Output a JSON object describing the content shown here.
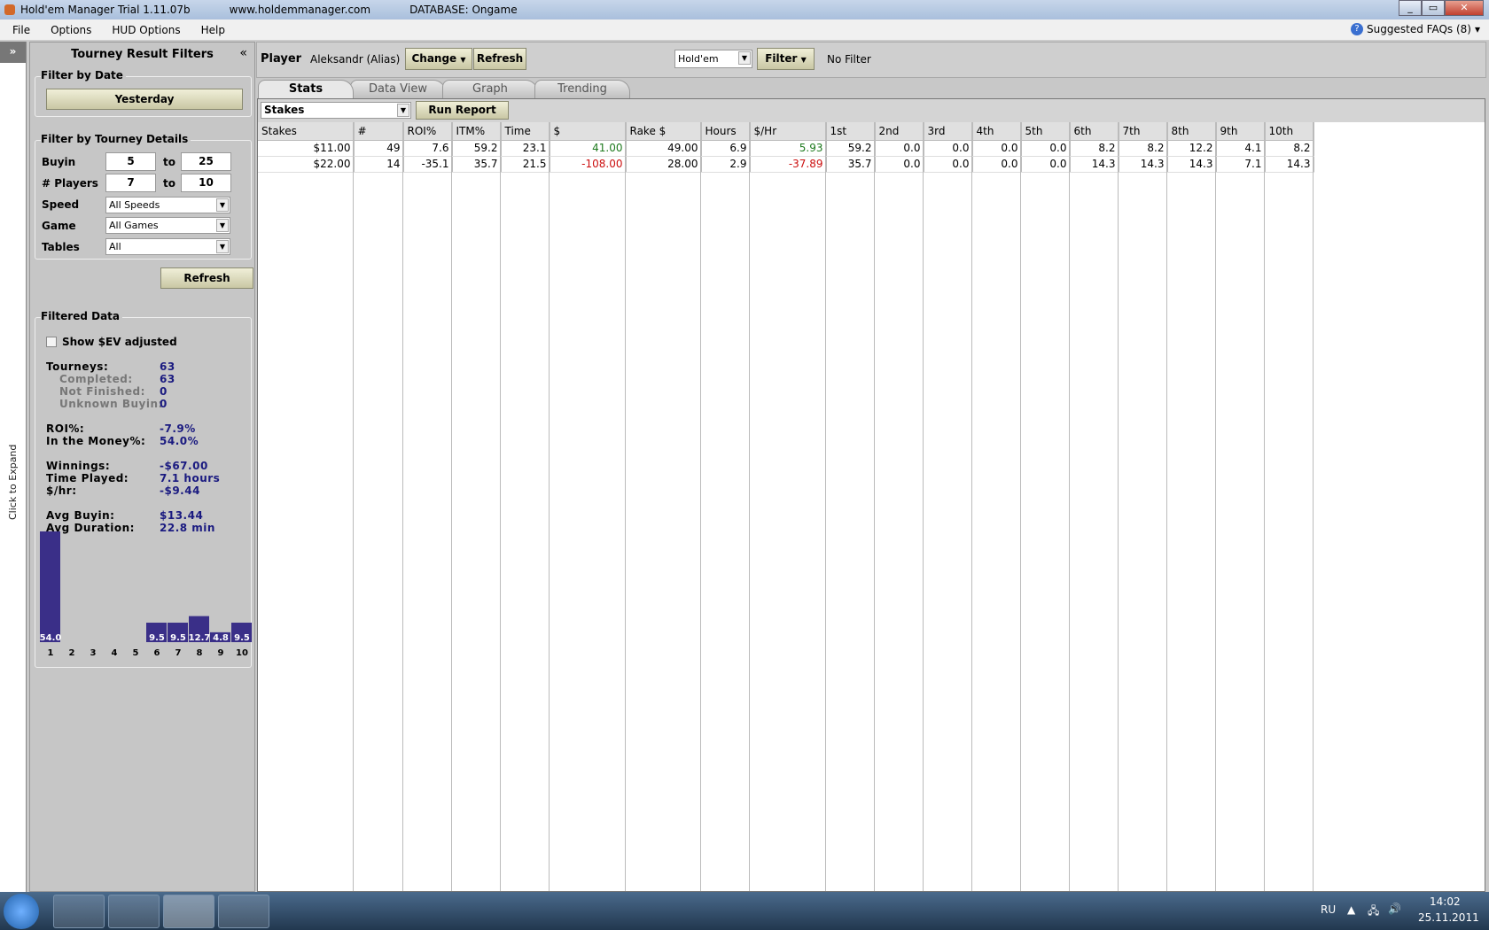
{
  "window": {
    "title": "Hold'em Manager Trial 1.11.07b",
    "url": "www.holdemmanager.com",
    "database": "DATABASE: Ongame"
  },
  "menu": [
    "File",
    "Options",
    "HUD Options",
    "Help"
  ],
  "faq": "Suggested FAQs (8)",
  "strip": {
    "expand": "»",
    "label": "Click to Expand"
  },
  "sidebar": {
    "title": "Tourney Result Filters",
    "collapse": "«",
    "date": {
      "legend": "Filter by Date",
      "button": "Yesterday"
    },
    "details": {
      "legend": "Filter by Tourney Details",
      "buyin_label": "Buyin",
      "buyin_from": "5",
      "to": "to",
      "buyin_to": "25",
      "players_label": "# Players",
      "players_from": "7",
      "players_to": "10",
      "speed_label": "Speed",
      "speed": "All Speeds",
      "game_label": "Game",
      "game": "All Games",
      "tables_label": "Tables",
      "tables": "All"
    },
    "refresh": "Refresh",
    "filtered": {
      "legend": "Filtered Data",
      "ev_label": "Show $EV adjusted",
      "ev_checked": false,
      "stats": [
        {
          "label": "Tourneys:",
          "value": "63",
          "sub": false
        },
        {
          "label": "Completed:",
          "value": "63",
          "sub": true
        },
        {
          "label": "Not Finished:",
          "value": "0",
          "sub": true
        },
        {
          "label": "Unknown Buyin:",
          "value": "0",
          "sub": true
        },
        {
          "label": "ROI%:",
          "value": "-7.9%",
          "sub": false
        },
        {
          "label": "In the Money%:",
          "value": "54.0%",
          "sub": false
        },
        {
          "label": "Winnings:",
          "value": "-$67.00",
          "sub": false
        },
        {
          "label": "Time Played:",
          "value": "7.1 hours",
          "sub": false
        },
        {
          "label": "$/hr:",
          "value": "-$9.44",
          "sub": false
        },
        {
          "label": "Avg Buyin:",
          "value": "$13.44",
          "sub": false
        },
        {
          "label": "Avg Duration:",
          "value": "22.8 min",
          "sub": false
        }
      ]
    }
  },
  "chart_data": {
    "type": "bar",
    "title": "Finish position distribution",
    "categories": [
      "1",
      "2",
      "3",
      "4",
      "5",
      "6",
      "7",
      "8",
      "9",
      "10"
    ],
    "values": [
      54.0,
      0,
      0,
      0,
      0,
      9.5,
      9.5,
      12.7,
      4.8,
      9.5
    ],
    "color": "#3a2f88"
  },
  "player": {
    "label": "Player",
    "name": "Aleksandr (Alias)",
    "change": "Change",
    "refresh": "Refresh",
    "game": "Hold'em",
    "filter": "Filter",
    "filter_status": "No Filter"
  },
  "tabs": [
    "Stats",
    "Data View",
    "Graph",
    "Trending"
  ],
  "report": {
    "group": "Stakes",
    "run": "Run Report"
  },
  "table": {
    "headers": [
      "Stakes",
      "#",
      "ROI%",
      "ITM%",
      "Time",
      "$",
      "Rake $",
      "Hours",
      "$/Hr",
      "1st",
      "2nd",
      "3rd",
      "4th",
      "5th",
      "6th",
      "7th",
      "8th",
      "9th",
      "10th"
    ],
    "rows": [
      [
        "$11.00",
        "49",
        "7.6",
        "59.2",
        "23.1",
        "41.00",
        "49.00",
        "6.9",
        "5.93",
        "59.2",
        "0.0",
        "0.0",
        "0.0",
        "0.0",
        "8.2",
        "8.2",
        "12.2",
        "4.1",
        "8.2"
      ],
      [
        "$22.00",
        "14",
        "-35.1",
        "35.7",
        "21.5",
        "-108.00",
        "28.00",
        "2.9",
        "-37.89",
        "35.7",
        "0.0",
        "0.0",
        "0.0",
        "0.0",
        "14.3",
        "14.3",
        "14.3",
        "7.1",
        "14.3"
      ]
    ]
  },
  "tray": {
    "lang": "RU",
    "time": "14:02",
    "date": "25.11.2011"
  }
}
